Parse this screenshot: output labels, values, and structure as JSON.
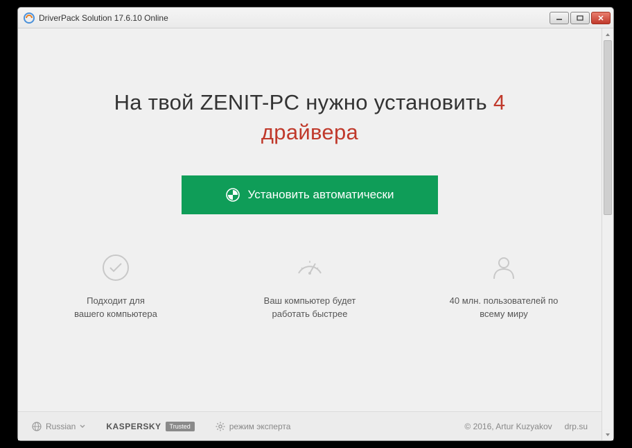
{
  "window": {
    "title": "DriverPack Solution 17.6.10 Online"
  },
  "headline": {
    "prefix": "На твой ",
    "pcname": "ZENIT-PC",
    "middle": " нужно установить ",
    "count": "4",
    "suffix": "драйвера"
  },
  "install_button": {
    "label": "Установить автоматически"
  },
  "features": [
    {
      "line1": "Подходит для",
      "line2": "вашего компьютера"
    },
    {
      "line1": "Ваш компьютер будет",
      "line2": "работать быстрее"
    },
    {
      "line1": "40 млн. пользователей по",
      "line2": "всему миру"
    }
  ],
  "footer": {
    "language": "Russian",
    "kaspersky": "KASPERSKY",
    "kaspersky_badge": "Trusted",
    "expert_mode": "режим эксперта",
    "copyright": "© 2016, Artur Kuzyakov",
    "site": "drp.su"
  }
}
